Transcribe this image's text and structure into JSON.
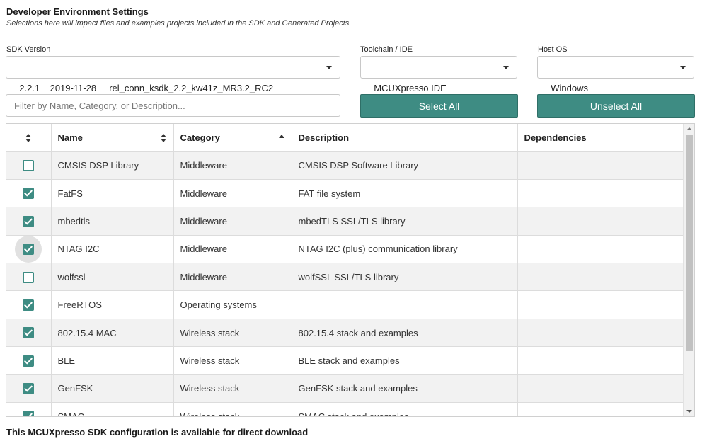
{
  "header": {
    "title": "Developer Environment Settings",
    "subtitle": "Selections here will impact files and examples projects included in the SDK and Generated Projects"
  },
  "sdk_version": {
    "label": "SDK Version",
    "value": "2.2.1    2019-11-28     rel_conn_ksdk_2.2_kw41z_MR3.2_RC2"
  },
  "toolchain": {
    "label": "Toolchain / IDE",
    "value": "MCUXpresso IDE"
  },
  "host_os": {
    "label": "Host OS",
    "value": "Windows"
  },
  "filter": {
    "placeholder": "Filter by Name, Category, or Description...",
    "value": ""
  },
  "buttons": {
    "select_all": "Select All",
    "unselect_all": "Unselect All"
  },
  "table": {
    "columns": [
      "Name",
      "Category",
      "Description",
      "Dependencies"
    ],
    "rows": [
      {
        "checked": false,
        "name": "CMSIS DSP Library",
        "category": "Middleware",
        "description": "CMSIS DSP Software Library",
        "dependencies": ""
      },
      {
        "checked": true,
        "name": "FatFS",
        "category": "Middleware",
        "description": "FAT file system",
        "dependencies": ""
      },
      {
        "checked": true,
        "name": "mbedtls",
        "category": "Middleware",
        "description": "mbedTLS SSL/TLS library",
        "dependencies": ""
      },
      {
        "checked": true,
        "focused": true,
        "name": "NTAG I2C",
        "category": "Middleware",
        "description": "NTAG I2C (plus) communication library",
        "dependencies": ""
      },
      {
        "checked": false,
        "name": "wolfssl",
        "category": "Middleware",
        "description": "wolfSSL SSL/TLS library",
        "dependencies": ""
      },
      {
        "checked": true,
        "name": "FreeRTOS",
        "category": "Operating systems",
        "description": "",
        "dependencies": ""
      },
      {
        "checked": true,
        "name": "802.15.4 MAC",
        "category": "Wireless stack",
        "description": "802.15.4 stack and examples",
        "dependencies": ""
      },
      {
        "checked": true,
        "name": "BLE",
        "category": "Wireless stack",
        "description": "BLE stack and examples",
        "dependencies": ""
      },
      {
        "checked": true,
        "name": "GenFSK",
        "category": "Wireless stack",
        "description": "GenFSK stack and examples",
        "dependencies": ""
      },
      {
        "checked": true,
        "name": "SMAC",
        "category": "Wireless stack",
        "description": "SMAC stack and examples",
        "dependencies": ""
      }
    ]
  },
  "footer": {
    "text": "This MCUXpresso SDK configuration is available for direct download"
  },
  "colors": {
    "accent": "#3e8c83",
    "row_alt": "#f2f2f2"
  },
  "icons": {
    "dropdown": "caret-down-icon",
    "sort": "sort-icon",
    "sort_asc": "sort-ascending-icon",
    "checkbox": "checkbox-icon"
  }
}
